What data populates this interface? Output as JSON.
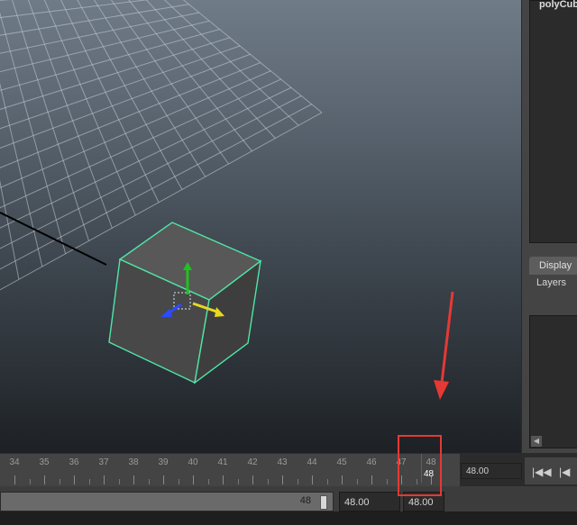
{
  "viewport": {
    "colors": {
      "wireframe": "#4fe6a6",
      "grid": "#c8ced4",
      "cube_face": "#4d4d4d"
    }
  },
  "outliner": {
    "selected_item": "polyCub"
  },
  "channel_box": {
    "display_tab": "Display",
    "layers_label": "Layers"
  },
  "timeline": {
    "ticks": [
      "34",
      "35",
      "36",
      "37",
      "38",
      "39",
      "40",
      "41",
      "42",
      "43",
      "44",
      "45",
      "46",
      "47",
      "48"
    ],
    "current_frame": "48",
    "current_time_field": "48.00"
  },
  "range": {
    "slider_end": "48",
    "end_time": "48.00",
    "playback_end": "48.00"
  },
  "playback": {
    "skip_back_label": "|◀◀",
    "step_back_label": "|◀"
  },
  "annotation": {
    "color": "#e53935"
  }
}
